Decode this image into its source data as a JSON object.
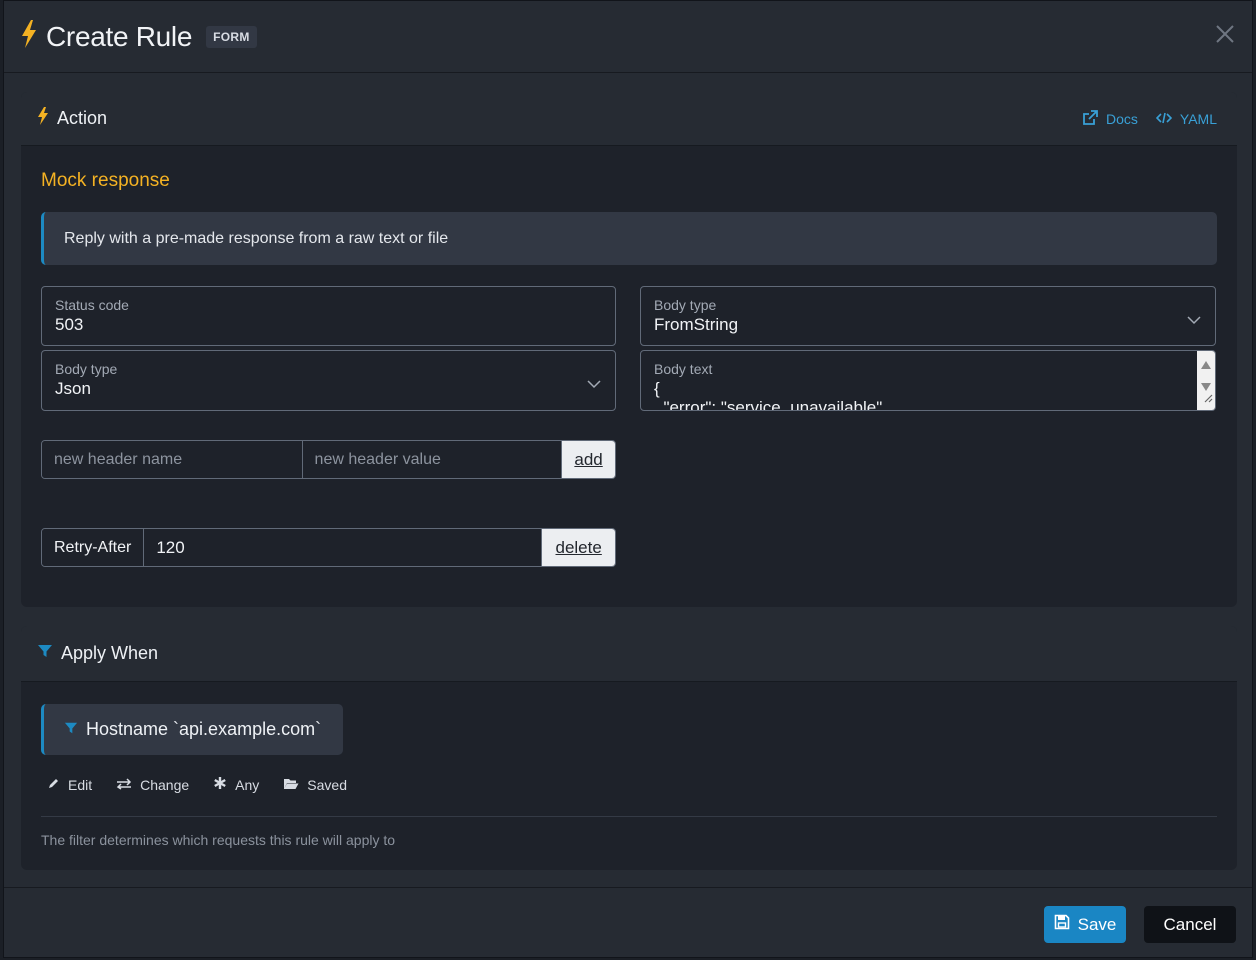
{
  "modal": {
    "title": "Create Rule",
    "badge": "FORM"
  },
  "action_card": {
    "title": "Action",
    "links": {
      "docs": "Docs",
      "yaml": "YAML"
    },
    "section_title": "Mock response",
    "info": "Reply with a pre-made response from a raw text or file",
    "status_code": {
      "label": "Status code",
      "value": "503"
    },
    "body_type_left": {
      "label": "Body type",
      "value": "Json"
    },
    "body_type_right": {
      "label": "Body type",
      "value": "FromString"
    },
    "body_text": {
      "label": "Body text",
      "value": "{\n  \"error\": \"service_unavailable\""
    },
    "new_header": {
      "name_placeholder": "new header name",
      "value_placeholder": "new header value",
      "add_label": "add"
    },
    "header_row": {
      "name": "Retry-After",
      "value": "120",
      "delete_label": "delete"
    }
  },
  "apply_card": {
    "title": "Apply When",
    "filter": "Hostname `api.example.com`",
    "actions": {
      "edit": "Edit",
      "change": "Change",
      "any": "Any",
      "saved": "Saved"
    },
    "helper": "The filter determines which requests this rule will apply to"
  },
  "footer": {
    "save": "Save",
    "cancel": "Cancel"
  },
  "colors": {
    "accent": "#1a86c4",
    "warning": "#f4b223",
    "link": "#39a0d6"
  }
}
